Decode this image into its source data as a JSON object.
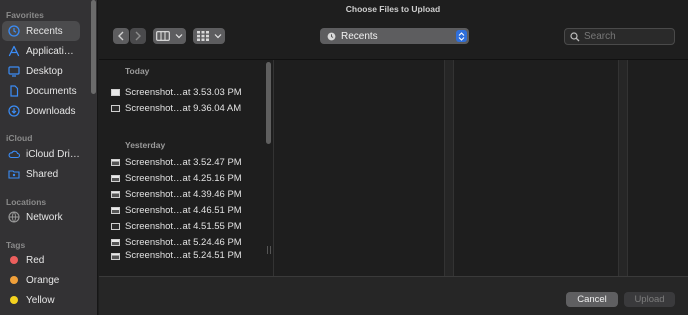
{
  "window": {
    "title": "Choose Files to Upload"
  },
  "sidebar": {
    "sections": {
      "favorites": "Favorites",
      "icloud": "iCloud",
      "locations": "Locations",
      "tags": "Tags"
    },
    "favorites": [
      {
        "label": "Recents",
        "icon": "clock-icon",
        "selected": true
      },
      {
        "label": "Applicati…",
        "icon": "apps-icon"
      },
      {
        "label": "Desktop",
        "icon": "desktop-icon"
      },
      {
        "label": "Documents",
        "icon": "document-icon"
      },
      {
        "label": "Downloads",
        "icon": "download-icon"
      }
    ],
    "icloud": [
      {
        "label": "iCloud Dri…",
        "icon": "cloud-icon"
      },
      {
        "label": "Shared",
        "icon": "shared-folder-icon"
      }
    ],
    "locations": [
      {
        "label": "Network",
        "icon": "globe-icon"
      }
    ],
    "tags": [
      {
        "label": "Red",
        "color": "#ec5f5d"
      },
      {
        "label": "Orange",
        "color": "#f0a03a"
      },
      {
        "label": "Yellow",
        "color": "#f4d21f"
      }
    ]
  },
  "toolbar": {
    "location": "Recents",
    "search_placeholder": "Search",
    "accent": "#2f6fdb"
  },
  "browser": {
    "groups": [
      {
        "heading": "Today",
        "files": [
          {
            "name": "Screenshot…at 3.53.03 PM",
            "thumb": "light"
          },
          {
            "name": "Screenshot…at 9.36.04 AM",
            "thumb": "dark"
          }
        ]
      },
      {
        "heading": "Yesterday",
        "files": [
          {
            "name": "Screenshot…at 3.52.47 PM",
            "thumb": "half"
          },
          {
            "name": "Screenshot…at 4.25.16 PM",
            "thumb": "half"
          },
          {
            "name": "Screenshot…at 4.39.46 PM",
            "thumb": "half"
          },
          {
            "name": "Screenshot…at 4.46.51 PM",
            "thumb": "half"
          },
          {
            "name": "Screenshot…at 4.51.55 PM",
            "thumb": "dark"
          },
          {
            "name": "Screenshot…at 5.24.46 PM",
            "thumb": "half"
          },
          {
            "name": "Screenshot…at 5.24.51 PM",
            "thumb": "half"
          }
        ]
      }
    ]
  },
  "footer": {
    "cancel": "Cancel",
    "upload": "Upload"
  }
}
